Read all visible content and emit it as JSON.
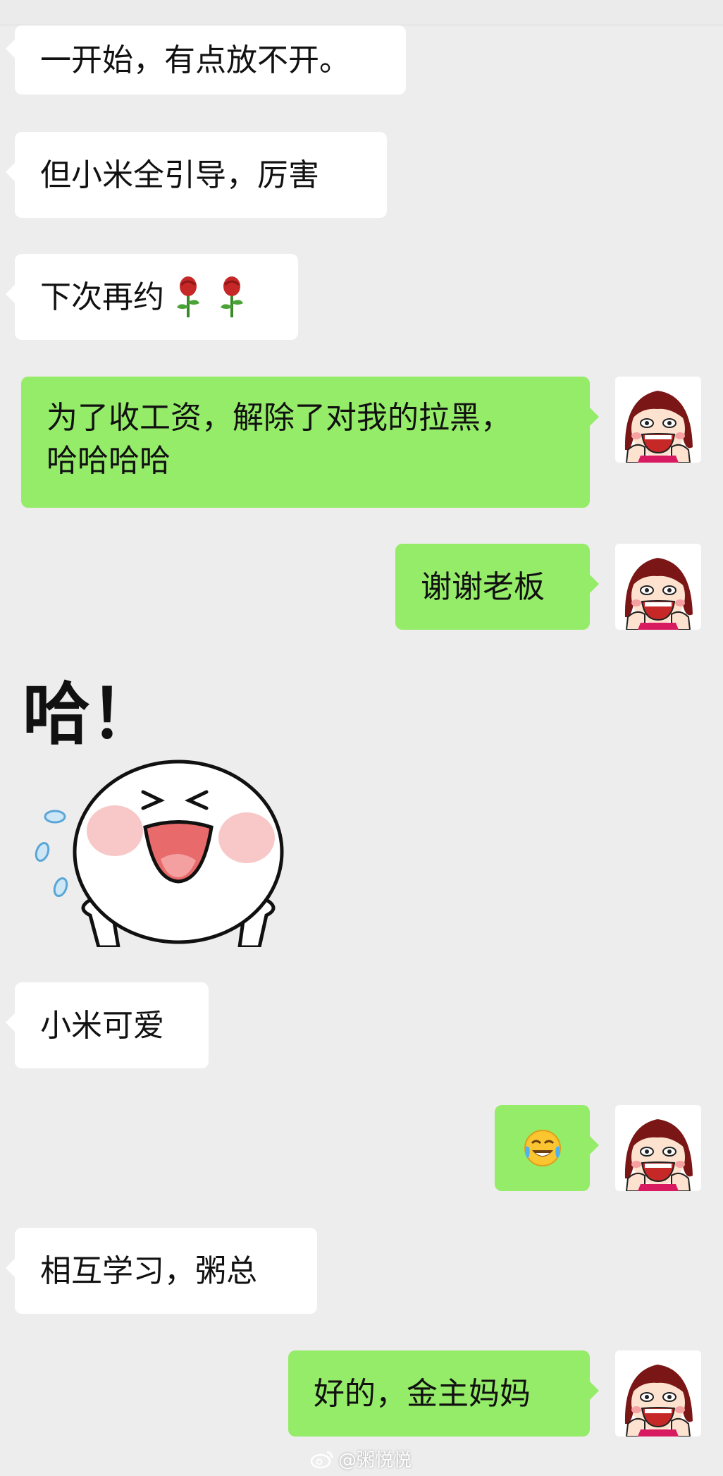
{
  "messages": [
    {
      "id": "m1",
      "side": "in",
      "text": "一开始，有点放不开。"
    },
    {
      "id": "m2",
      "side": "in",
      "text": "但小米全引导，厉害"
    },
    {
      "id": "m3",
      "side": "in",
      "text": "下次再约"
    },
    {
      "id": "m4",
      "side": "out",
      "line1": "为了收工资，解除了对我的拉黑，",
      "line2": "哈哈哈哈"
    },
    {
      "id": "m5",
      "side": "out",
      "text": "谢谢老板"
    },
    {
      "id": "m6",
      "side": "in",
      "type": "sticker",
      "caption": "哈！"
    },
    {
      "id": "m7",
      "side": "in",
      "text": "小米可爱"
    },
    {
      "id": "m8",
      "side": "out",
      "type": "emoji",
      "emoji_name": "laughing-crying-emoji"
    },
    {
      "id": "m9",
      "side": "in",
      "text": "相互学习，粥总"
    },
    {
      "id": "m10",
      "side": "out",
      "text": "好的，金主妈妈"
    }
  ],
  "icons": {
    "rose": "rose-icon",
    "avatar": "cartoon-girl-avatar"
  },
  "watermark": "@粥悦悦",
  "colors": {
    "background": "#ededed",
    "outgoing_bubble": "#95ec69",
    "incoming_bubble": "#ffffff"
  }
}
